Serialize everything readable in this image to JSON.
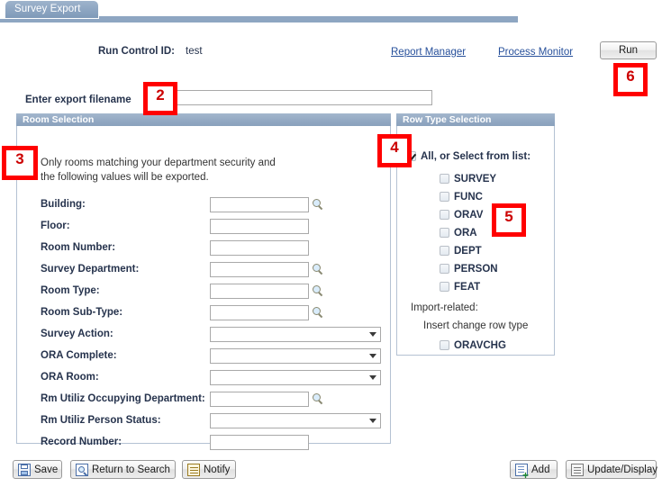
{
  "window": {
    "tab_label": "Survey Export"
  },
  "header": {
    "run_control_label": "Run Control ID:",
    "run_control_value": "test",
    "report_manager_link": "Report Manager",
    "process_monitor_link": "Process Monitor",
    "run_button": "Run"
  },
  "export": {
    "label": "Enter export filename",
    "value": "",
    "placeholder": ""
  },
  "room_selection": {
    "title": "Room Selection",
    "description_line1": "Only rooms matching your department security and",
    "description_line2": "the following values will be exported.",
    "fields": [
      {
        "label": "Building:",
        "type": "text",
        "value": "",
        "lookup": true
      },
      {
        "label": "Floor:",
        "type": "text",
        "value": "",
        "lookup": false
      },
      {
        "label": "Room Number:",
        "type": "text",
        "value": "",
        "lookup": false
      },
      {
        "label": "Survey Department:",
        "type": "text",
        "value": "",
        "lookup": true
      },
      {
        "label": "Room Type:",
        "type": "text",
        "value": "",
        "lookup": true
      },
      {
        "label": "Room Sub-Type:",
        "type": "text",
        "value": "",
        "lookup": true
      },
      {
        "label": "Survey Action:",
        "type": "select",
        "value": "",
        "lookup": false
      },
      {
        "label": "ORA Complete:",
        "type": "select",
        "value": "",
        "lookup": false
      },
      {
        "label": "ORA Room:",
        "type": "select",
        "value": "",
        "lookup": false
      },
      {
        "label": "Rm Utiliz Occupying Department:",
        "type": "text",
        "value": "",
        "lookup": true
      },
      {
        "label": "Rm Utiliz Person Status:",
        "type": "select",
        "value": "",
        "lookup": false
      },
      {
        "label": "Record Number:",
        "type": "text",
        "value": "",
        "lookup": false
      }
    ]
  },
  "row_type_selection": {
    "title": "Row Type Selection",
    "all_label": "All, or Select from list:",
    "all_checked": true,
    "items": [
      {
        "label": "SURVEY",
        "checked": false
      },
      {
        "label": "FUNC",
        "checked": false
      },
      {
        "label": "ORAV",
        "checked": false
      },
      {
        "label": "ORA",
        "checked": false
      },
      {
        "label": "DEPT",
        "checked": false
      },
      {
        "label": "PERSON",
        "checked": false
      },
      {
        "label": "FEAT",
        "checked": false
      }
    ],
    "import_related_label": "Import-related:",
    "insert_change_label": "Insert change row type",
    "import_items": [
      {
        "label": "ORAVCHG",
        "checked": false
      }
    ]
  },
  "toolbar": {
    "save_label": "Save",
    "return_to_search_label": "Return to Search",
    "notify_label": "Notify",
    "add_label": "Add",
    "update_display_label": "Update/Display"
  },
  "annotations": [
    {
      "number": "2"
    },
    {
      "number": "3"
    },
    {
      "number": "4"
    },
    {
      "number": "5"
    },
    {
      "number": "6"
    }
  ],
  "colors": {
    "tab": "#8ea6c2",
    "group_header": "#93a9c3",
    "link": "#27509b",
    "label": "#26334d",
    "annotation": "#ff0000"
  }
}
